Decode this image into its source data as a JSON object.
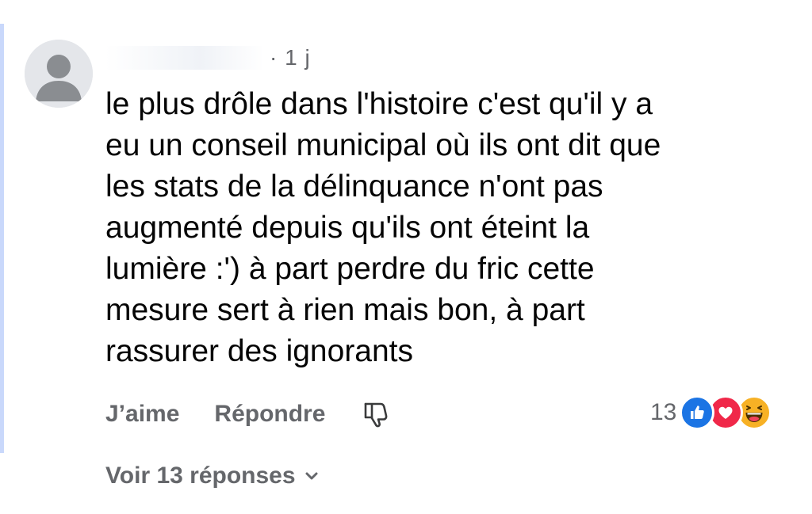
{
  "comment": {
    "author_name": "",
    "time_ago": "· 1 j",
    "text": "le plus drôle dans l'histoire c'est qu'il y a\neu un conseil municipal où ils ont dit que\nles stats de la délinquance n'ont pas\naugmenté depuis qu'ils ont éteint la\nlumière :') à part perdre du fric cette\nmesure sert à rien mais bon, à part\nrassurer des ignorants",
    "avatar_icon": "default-user-avatar-icon"
  },
  "actions": {
    "like_label": "J’aime",
    "reply_label": "Répondre",
    "dislike_icon": "thumbs-down-icon"
  },
  "reactions": {
    "count": "13",
    "types": [
      "like",
      "love",
      "haha"
    ]
  },
  "replies": {
    "view_label": "Voir 13 réponses",
    "chevron_icon": "chevron-down-icon"
  },
  "colors": {
    "thread_line": "#c9d8fb",
    "secondary_text": "#65676b",
    "primary_text": "#050505",
    "like_blue": "#1b74e4",
    "love_red": "#f02849",
    "haha_yellow": "#f7b125"
  }
}
